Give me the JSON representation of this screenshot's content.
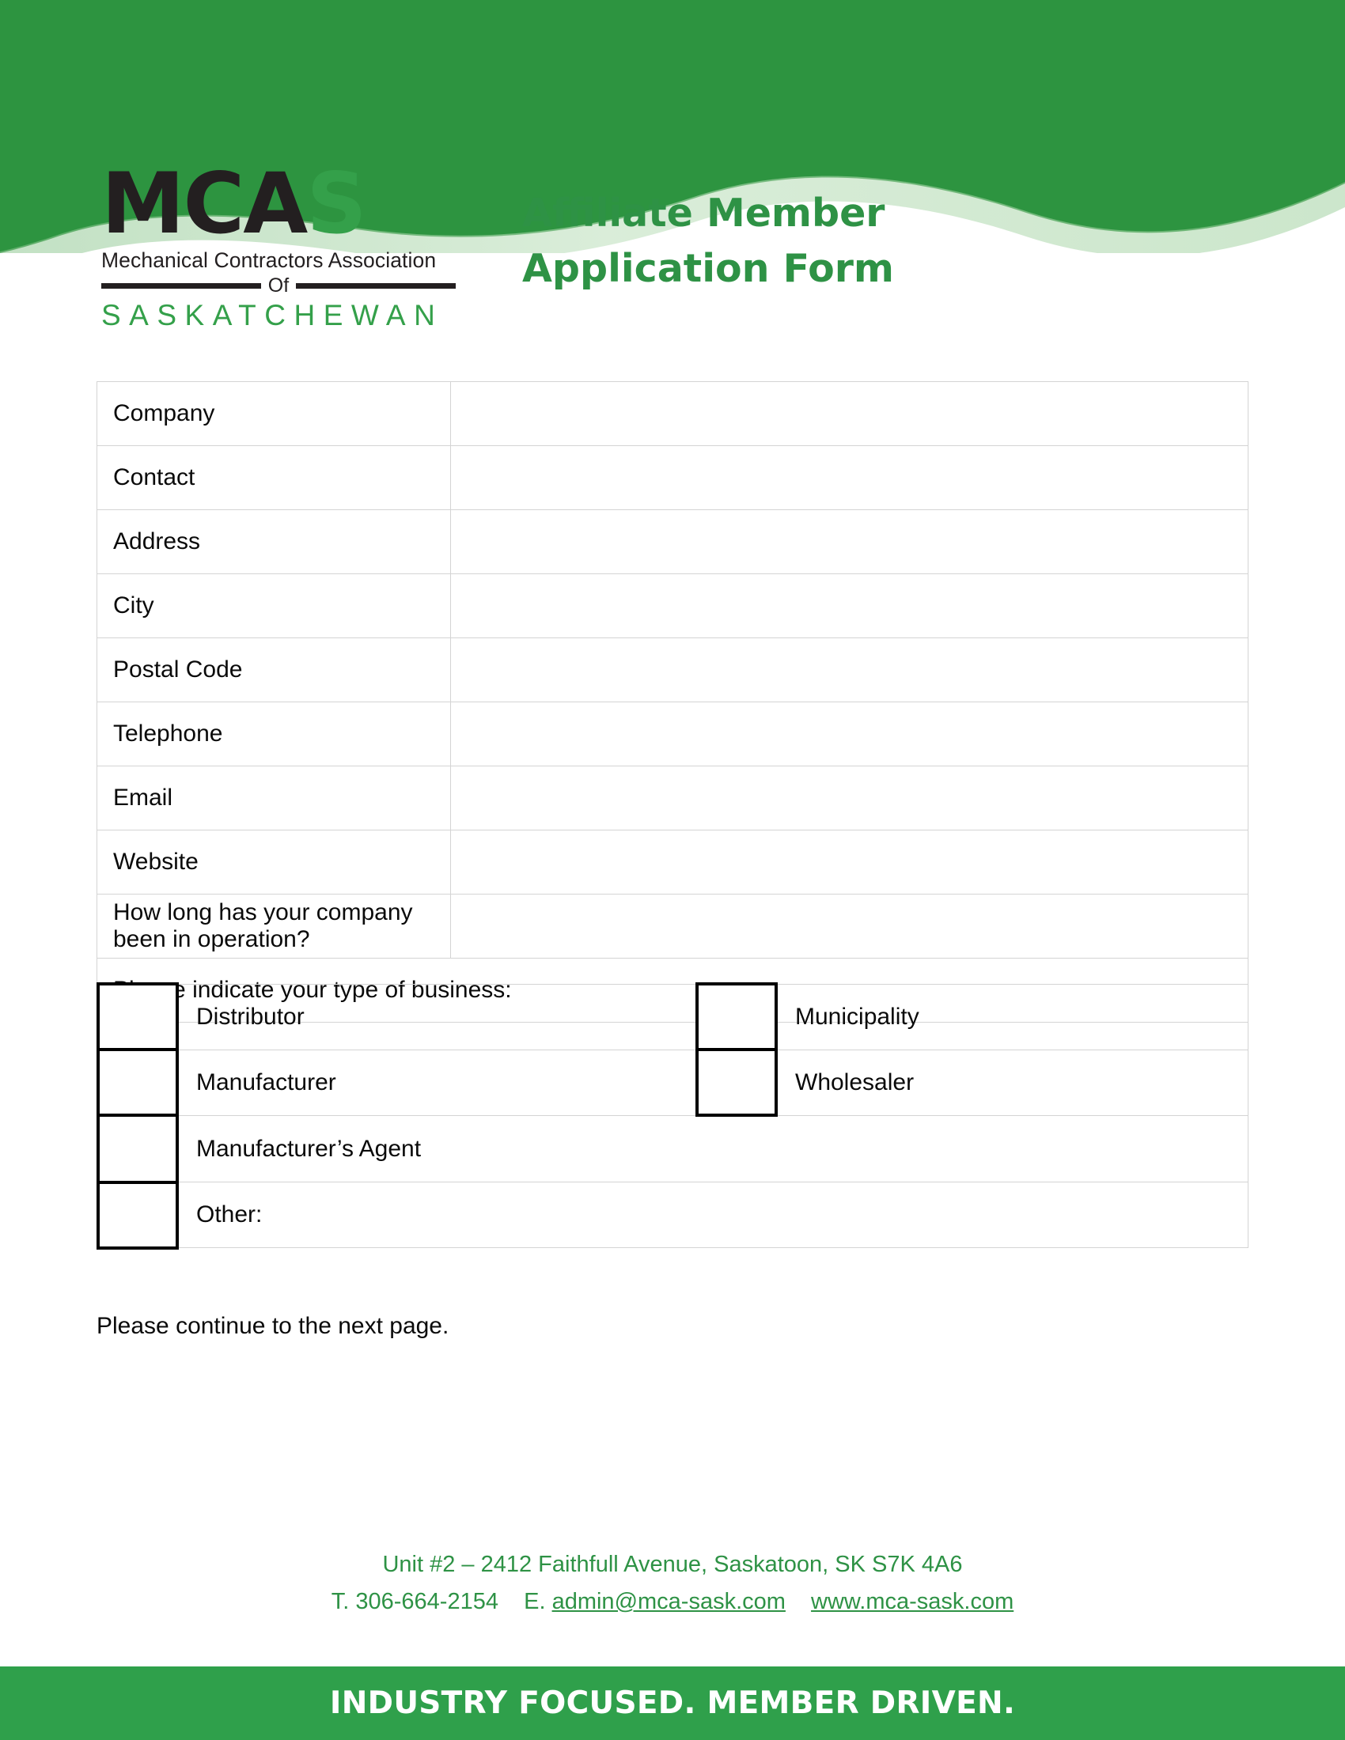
{
  "logo": {
    "wordmark_dark": "MCA",
    "wordmark_accent": "S",
    "tagline": "Mechanical Contractors Association",
    "of_label": "Of",
    "province": "SASKATCHEWAN",
    "accent_color": "#34a04a",
    "dark_color": "#231f20"
  },
  "header": {
    "title_line1": "Affiliate Member",
    "title_line2": "Application Form",
    "title_color": "#2e9245",
    "wave_color": "#2d9440",
    "wave_highlight_color": "#a8d4a8"
  },
  "form": {
    "fields": [
      {
        "label": "Company",
        "value": ""
      },
      {
        "label": "Contact",
        "value": ""
      },
      {
        "label": "Address",
        "value": ""
      },
      {
        "label": "City",
        "value": ""
      },
      {
        "label": "Postal Code",
        "value": ""
      },
      {
        "label": "Telephone",
        "value": ""
      },
      {
        "label": "Email",
        "value": ""
      },
      {
        "label": "Website",
        "value": ""
      }
    ],
    "operation_question": "How long has your company been in operation?",
    "operation_answer": "",
    "business_type_prompt": "Please indicate your type of business:",
    "business_types_left": [
      {
        "label": "Distributor",
        "checked": false
      },
      {
        "label": "Manufacturer",
        "checked": false
      },
      {
        "label": "Manufacturer’s Agent",
        "checked": false
      },
      {
        "label": "Other:",
        "checked": false
      }
    ],
    "business_types_right": [
      {
        "label": "Municipality",
        "checked": false
      },
      {
        "label": "Wholesaler",
        "checked": false
      }
    ],
    "other_value": "",
    "continue_note": "Please continue to the next page."
  },
  "footer": {
    "address": "Unit #2 – 2412 Faithfull Avenue, Saskatoon, SK  S7K 4A6",
    "phone_label": "T.",
    "phone": "306-664-2154",
    "email_label": "E.",
    "email": "admin@mca-sask.com",
    "website": "www.mca-sask.com",
    "link_color": "#2e9245",
    "tagline": "INDUSTRY FOCUSED.  MEMBER DRIVEN.",
    "bar_color": "#2fa04b"
  }
}
